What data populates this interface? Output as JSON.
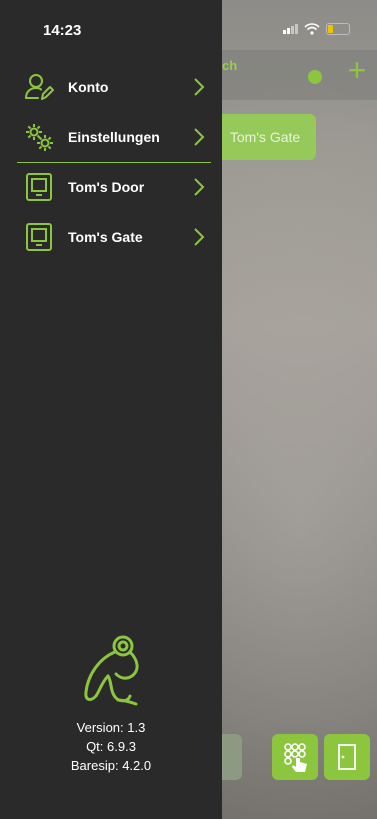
{
  "status_bar": {
    "time": "14:23"
  },
  "background": {
    "title_fragment": "ch",
    "gate_button": "Tom's Gate"
  },
  "drawer": {
    "items": [
      {
        "label": "Konto",
        "icon": "user-edit-icon"
      },
      {
        "label": "Einstellungen",
        "icon": "gears-icon"
      },
      {
        "label": "Tom's Door",
        "icon": "intercom-device-icon"
      },
      {
        "label": "Tom's Gate",
        "icon": "intercom-device-icon"
      }
    ],
    "version": "Version: 1.3",
    "qt": "Qt: 6.9.3",
    "baresip": "Baresip: 4.2.0"
  },
  "colors": {
    "accent": "#8cc63f",
    "drawer_bg": "#2a2a2a"
  }
}
